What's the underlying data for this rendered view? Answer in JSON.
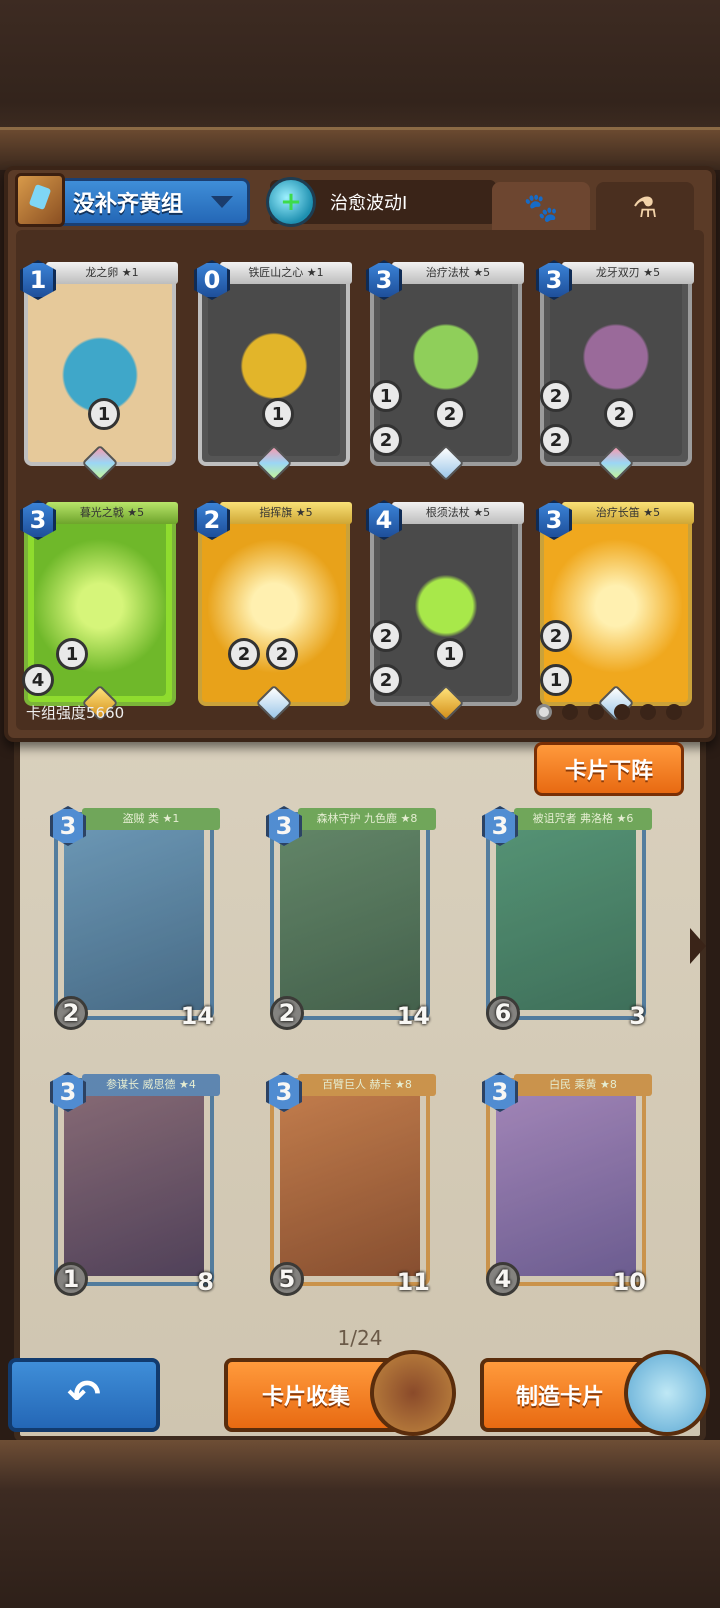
{
  "deck": {
    "name": "没补齐黄组",
    "skill_name": "治愈波动I",
    "strength_label": "卡组强度5660",
    "tabs": [
      "paw-icon",
      "potion-icon"
    ],
    "cards": [
      {
        "name": "龙之卵 ★1",
        "cost": "1",
        "stats": [
          "1"
        ],
        "frame": "tan",
        "art": "#3fa7c9"
      },
      {
        "name": "铁匠山之心 ★1",
        "cost": "0",
        "stats": [
          "1"
        ],
        "frame": "tan",
        "art": "#c9a22a"
      },
      {
        "name": "治疗法杖 ★5",
        "cost": "3",
        "stats": [
          "1",
          "2",
          "2"
        ],
        "frame": "silver",
        "art": "#8fcf5a"
      },
      {
        "name": "龙牙双刃 ★5",
        "cost": "3",
        "stats": [
          "2",
          "2",
          "2"
        ],
        "frame": "silver",
        "art": "#7a6a7a"
      },
      {
        "name": "暮光之戟 ★5",
        "cost": "3",
        "stats": [
          "1",
          "4"
        ],
        "frame": "green",
        "art": "#8fdc2e"
      },
      {
        "name": "指挥旗 ★5",
        "cost": "2",
        "stats": [
          "2",
          "2"
        ],
        "frame": "gold",
        "art": "#e8a21a"
      },
      {
        "name": "根须法杖 ★5",
        "cost": "4",
        "stats": [
          "2",
          "1",
          "2"
        ],
        "frame": "silver",
        "art": "#7ab83a"
      },
      {
        "name": "治疗长笛 ★5",
        "cost": "3",
        "stats": [
          "2",
          "1"
        ],
        "frame": "gold",
        "art": "#f0a81e"
      }
    ]
  },
  "collection": {
    "remove_button": "卡片下阵",
    "page": "1/24",
    "cards": [
      {
        "name": "盗贼 类 ★1",
        "cost": "3",
        "atk": "2",
        "hp": "14"
      },
      {
        "name": "森林守护 九色鹿 ★8",
        "cost": "3",
        "atk": "2",
        "hp": "14"
      },
      {
        "name": "被诅咒者 弗洛格 ★6",
        "cost": "3",
        "atk": "6",
        "hp": "3"
      },
      {
        "name": "参谋长 威思德 ★4",
        "cost": "3",
        "atk": "1",
        "hp": "8"
      },
      {
        "name": "百臂巨人 赫卡 ★8",
        "cost": "3",
        "atk": "5",
        "hp": "11"
      },
      {
        "name": "白民 乘黄 ★8",
        "cost": "3",
        "atk": "4",
        "hp": "10"
      }
    ]
  },
  "buttons": {
    "collect": "卡片收集",
    "craft": "制造卡片"
  },
  "colors": {
    "accent_orange": "#e86a12",
    "accent_blue": "#2467b6"
  }
}
